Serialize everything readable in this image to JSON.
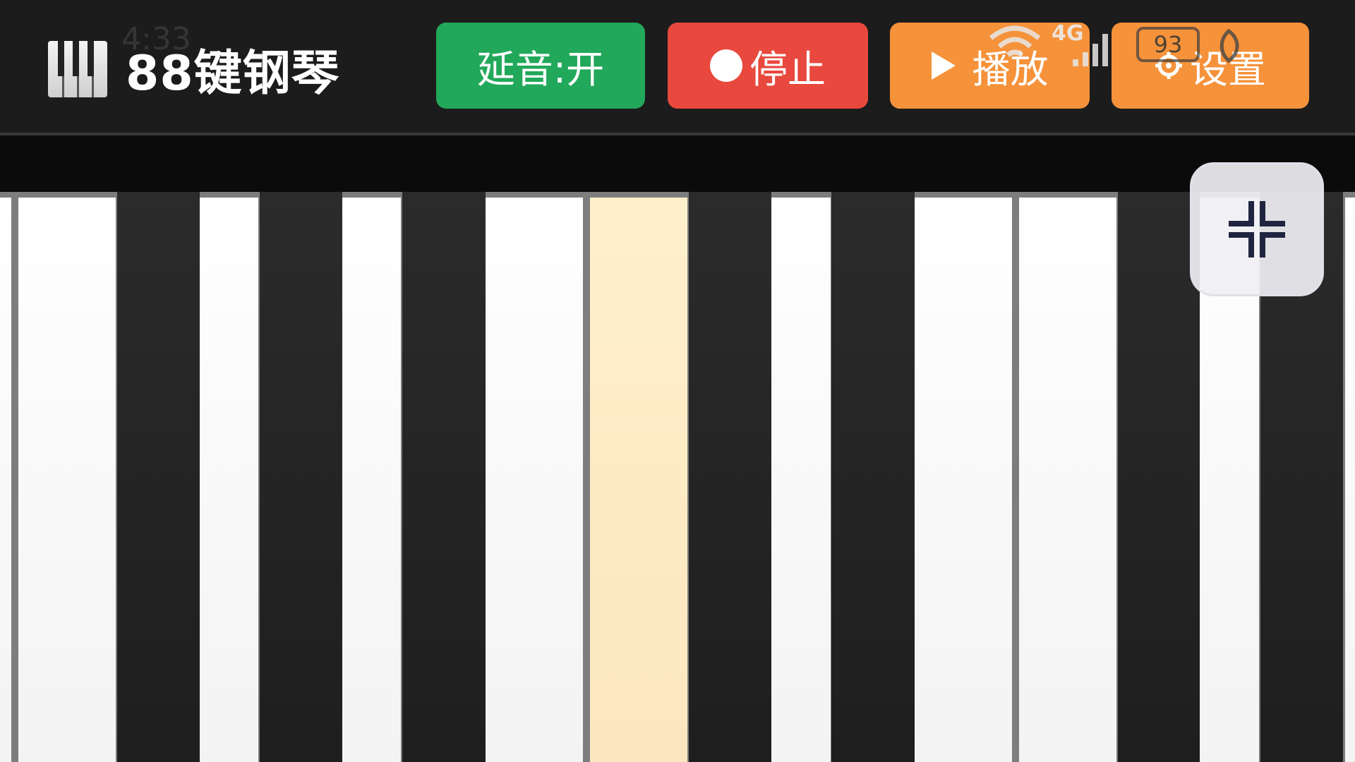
{
  "header": {
    "title": "88键钢琴",
    "logo_icon": "piano-keys-icon"
  },
  "status_bar": {
    "time": "4:33",
    "network": "4G",
    "battery": "93"
  },
  "toolbar": {
    "sustain_label": "延音:开",
    "stop_label": "停止",
    "play_label": "播放",
    "settings_label": "设置"
  },
  "colors": {
    "sustain": "#22a85a",
    "stop": "#e8483d",
    "play": "#f5923a",
    "settings": "#f5923a",
    "pressed_key": "#fdebc6"
  },
  "keyboard": {
    "visible_white_keys": 12,
    "pressed_key": "white-key-6"
  },
  "collapse_button": {
    "icon": "collapse-icon"
  }
}
